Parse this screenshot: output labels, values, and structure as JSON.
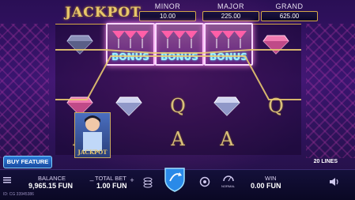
{
  "header": {
    "title": "JACKPOT",
    "jackpots": [
      {
        "label": "MINOR",
        "value": "10.00"
      },
      {
        "label": "MAJOR",
        "value": "225.00"
      },
      {
        "label": "GRAND",
        "value": "625.00"
      }
    ]
  },
  "reels": {
    "bonus_text": "BONUS",
    "symbols": [
      "Q",
      "Q",
      "A",
      "A",
      "A"
    ],
    "lady_label": "JACKPOT"
  },
  "controls": {
    "buy_feature": "BUY FEATURE",
    "lines": "20 LINES"
  },
  "footer": {
    "balance_label": "BALANCE",
    "balance_value": "9,965.15 FUN",
    "total_bet_label": "TOTAL BET",
    "total_bet_value": "1.00 FUN",
    "win_label": "WIN",
    "win_value": "0.00 FUN",
    "minus": "–",
    "plus": "+",
    "normal_label": "NORMAL",
    "session_id": "ID: CG 33945386"
  },
  "colors": {
    "gold": "#d4a848",
    "accent_pink": "#ff88e8",
    "bonus_cyan": "#9ff2ff"
  }
}
